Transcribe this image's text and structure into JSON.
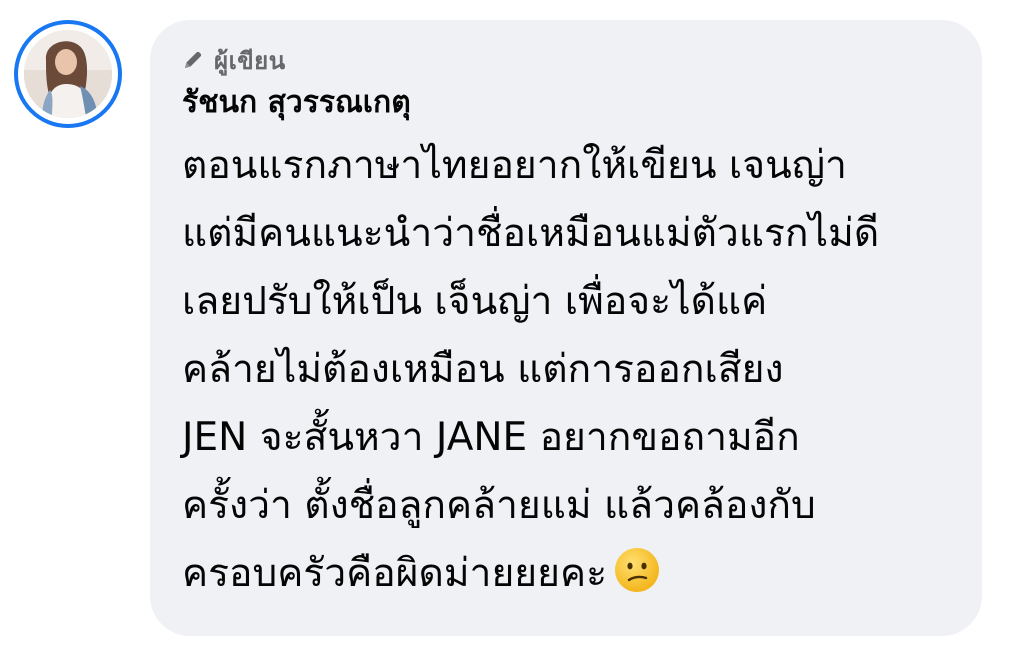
{
  "comment": {
    "author_badge": "ผู้เขียน",
    "author_badge_icon": "pencil-icon",
    "author_name": "รัชนก สุวรรณเกตุ",
    "text": "ตอนแรกภาษาไทยอยากให้เขียน เจนญ่า\nแต่มีคนแนะนำว่าชื่อเหมือนแม่ตัวแรกไม่ดี\nเลยปรับให้เป็น เจ็นญ่า เพื่อจะได้แค่\nคล้ายไม่ต้องเหมือน แต่การออกเสียง\nJEN จะสั้นหวา JANE อยากขอถามอีก\nครั้งว่า ตั้งชื่อลูกคล้ายแม่ แล้วคล้องกับ\nครอบครัวคือผิดม่ายยยคะ",
    "emoji": "confused-face-emoji"
  },
  "colors": {
    "avatar_ring": "#1877f2",
    "bubble_bg": "#eff1f5",
    "badge_text": "#65676b",
    "body_text": "#050505"
  }
}
